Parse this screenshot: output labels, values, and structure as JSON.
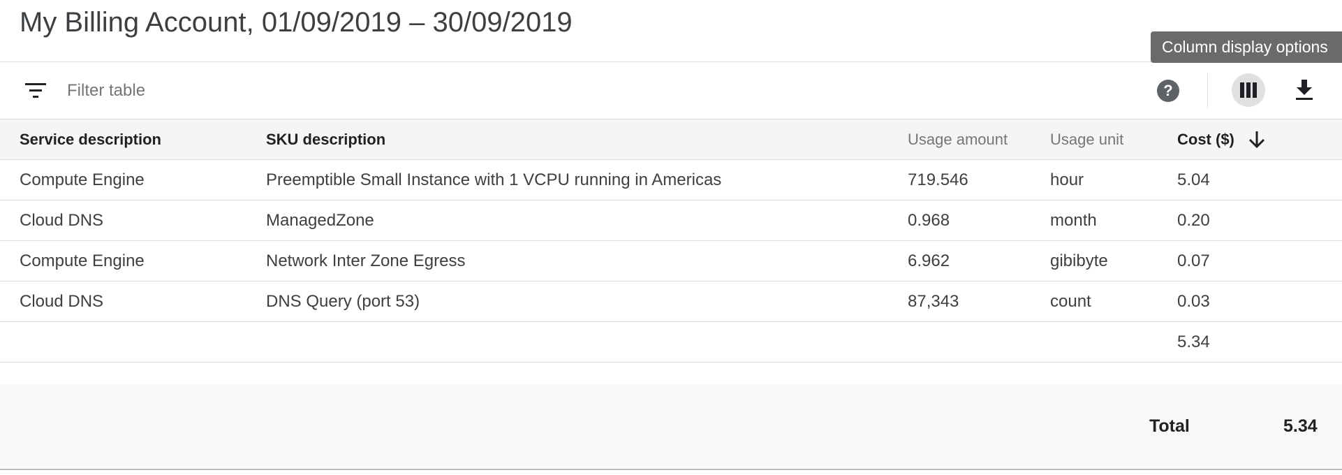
{
  "header": {
    "title": "My Billing Account, 01/09/2019 – 30/09/2019"
  },
  "toolbar": {
    "filter_icon": "filter-list-icon",
    "filter_placeholder": "Filter table",
    "filter_value": "",
    "help_icon": "help-icon",
    "help_glyph": "?",
    "columns_icon": "view-column-icon",
    "download_icon": "download-icon",
    "tooltip": "Column display options"
  },
  "table": {
    "columns": [
      {
        "label": "Service description"
      },
      {
        "label": "SKU description"
      },
      {
        "label": "Usage amount"
      },
      {
        "label": "Usage unit"
      },
      {
        "label": "Cost ($)",
        "sort": "descending",
        "sort_icon": "arrow-down-icon"
      }
    ],
    "rows": [
      {
        "service": "Compute Engine",
        "sku": "Preemptible Small Instance with 1 VCPU running in Americas",
        "amount": "719.546",
        "unit": "hour",
        "cost": "5.04"
      },
      {
        "service": "Cloud DNS",
        "sku": "ManagedZone",
        "amount": "0.968",
        "unit": "month",
        "cost": "0.20"
      },
      {
        "service": "Compute Engine",
        "sku": "Network Inter Zone Egress",
        "amount": "6.962",
        "unit": "gibibyte",
        "cost": "0.07"
      },
      {
        "service": "Cloud DNS",
        "sku": "DNS Query (port 53)",
        "amount": "87,343",
        "unit": "count",
        "cost": "0.03"
      }
    ],
    "subtotal": "5.34"
  },
  "footer": {
    "total_label": "Total",
    "total_value": "5.34"
  },
  "colors": {
    "divider": "#dadce0",
    "header_bg": "#f5f5f5",
    "tooltip_bg": "#6a6a6a",
    "icon": "#202124"
  }
}
